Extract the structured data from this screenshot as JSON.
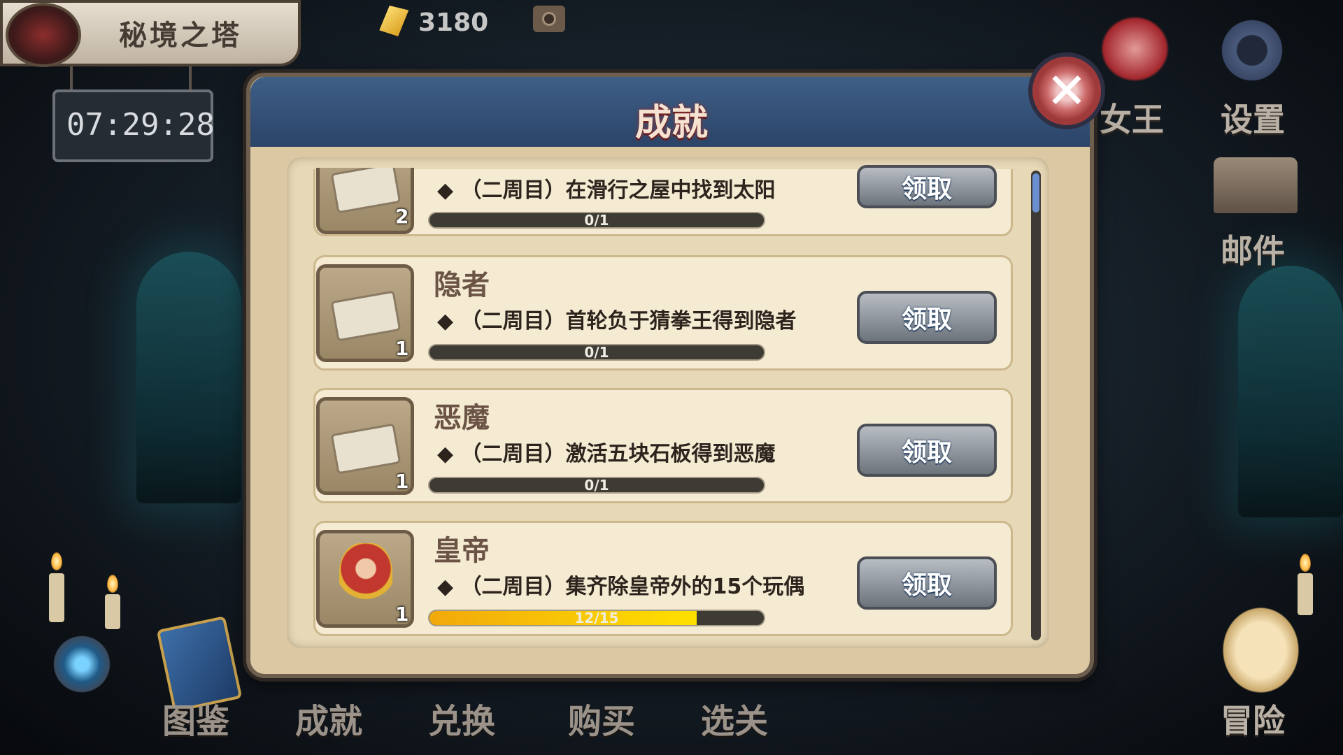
{
  "header": {
    "title": "秘境之塔",
    "timer": "07:29:28",
    "currency_amount": "3180"
  },
  "side_menu": {
    "queen_label": "女王",
    "settings_label": "设置",
    "mail_label": "邮件",
    "adventure_label": "冒险"
  },
  "bottom_menu": {
    "items": [
      "图鉴",
      "成就",
      "兑换",
      "购买",
      "选关"
    ]
  },
  "modal": {
    "title": "成就",
    "close_icon": "close-icon",
    "achievements": [
      {
        "name": "",
        "description": "◆ （二周目）在滑行之屋中找到太阳",
        "progress_text": "0/1",
        "progress": 0,
        "reward_count": "2",
        "button_label": "领取"
      },
      {
        "name": "隐者",
        "description": "◆ （二周目）首轮负于猜拳王得到隐者",
        "progress_text": "0/1",
        "progress": 0,
        "reward_count": "1",
        "button_label": "领取"
      },
      {
        "name": "恶魔",
        "description": "◆ （二周目）激活五块石板得到恶魔",
        "progress_text": "0/1",
        "progress": 0,
        "reward_count": "1",
        "button_label": "领取"
      },
      {
        "name": "皇帝",
        "description": "◆ （二周目）集齐除皇帝外的15个玩偶",
        "progress_text": "12/15",
        "progress": 0.8,
        "reward_count": "1",
        "button_label": "领取"
      }
    ]
  },
  "colors": {
    "progress_fill": "#f2a90b",
    "modal_header": "#2b4468",
    "claim_button": "#8c9299"
  }
}
